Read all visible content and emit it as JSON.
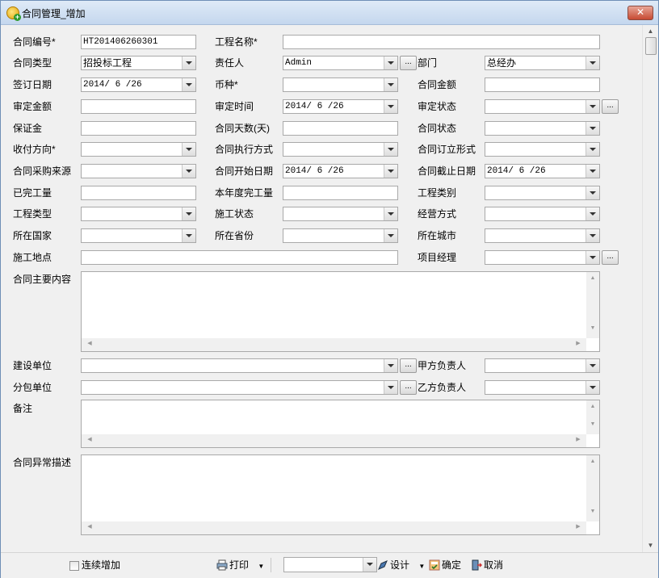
{
  "window": {
    "title": "合同管理_增加",
    "close_label": "✕"
  },
  "form": {
    "contract_no": {
      "label": "合同编号*",
      "value": "HT201406260301"
    },
    "project_name": {
      "label": "工程名称*",
      "value": ""
    },
    "contract_type": {
      "label": "合同类型",
      "value": "招投标工程"
    },
    "responsible": {
      "label": "责任人",
      "value": "Admin"
    },
    "department": {
      "label": "部门",
      "value": "总经办"
    },
    "sign_date": {
      "label": "签订日期",
      "value": "2014/ 6 /26"
    },
    "currency": {
      "label": "币种*",
      "value": ""
    },
    "contract_amount": {
      "label": "合同金额",
      "value": ""
    },
    "approved_amount": {
      "label": "审定金额",
      "value": ""
    },
    "approved_time": {
      "label": "审定时间",
      "value": "2014/ 6 /26"
    },
    "approval_status": {
      "label": "审定状态",
      "value": ""
    },
    "deposit": {
      "label": "保证金",
      "value": ""
    },
    "contract_days": {
      "label": "合同天数(天)",
      "value": ""
    },
    "contract_status": {
      "label": "合同状态",
      "value": ""
    },
    "payment_direction": {
      "label": "收付方向*",
      "value": ""
    },
    "execution_method": {
      "label": "合同执行方式",
      "value": ""
    },
    "signing_form": {
      "label": "合同订立形式",
      "value": ""
    },
    "procurement_source": {
      "label": "合同采购来源",
      "value": ""
    },
    "start_date": {
      "label": "合同开始日期",
      "value": "2014/ 6 /26"
    },
    "end_date": {
      "label": "合同截止日期",
      "value": "2014/ 6 /26"
    },
    "completed_work": {
      "label": "已完工量",
      "value": ""
    },
    "year_completed": {
      "label": "本年度完工量",
      "value": ""
    },
    "project_category": {
      "label": "工程类别",
      "value": ""
    },
    "project_type": {
      "label": "工程类型",
      "value": ""
    },
    "construction_status": {
      "label": "施工状态",
      "value": ""
    },
    "business_mode": {
      "label": "经营方式",
      "value": ""
    },
    "country": {
      "label": "所在国家",
      "value": ""
    },
    "province": {
      "label": "所在省份",
      "value": ""
    },
    "city": {
      "label": "所在城市",
      "value": ""
    },
    "site": {
      "label": "施工地点",
      "value": ""
    },
    "project_manager": {
      "label": "项目经理",
      "value": ""
    },
    "main_content": {
      "label": "合同主要内容"
    },
    "builder": {
      "label": "建设单位",
      "value": ""
    },
    "party_a": {
      "label": "甲方负责人",
      "value": ""
    },
    "subcontractor": {
      "label": "分包单位",
      "value": ""
    },
    "party_b": {
      "label": "乙方负责人",
      "value": ""
    },
    "remarks": {
      "label": "备注"
    },
    "exception": {
      "label": "合同异常描述"
    },
    "ellipsis": "..."
  },
  "toolbar": {
    "continuous_add": "连续增加",
    "print": "打印",
    "design": "设计",
    "confirm": "确定",
    "cancel": "取消",
    "design_select_value": ""
  }
}
